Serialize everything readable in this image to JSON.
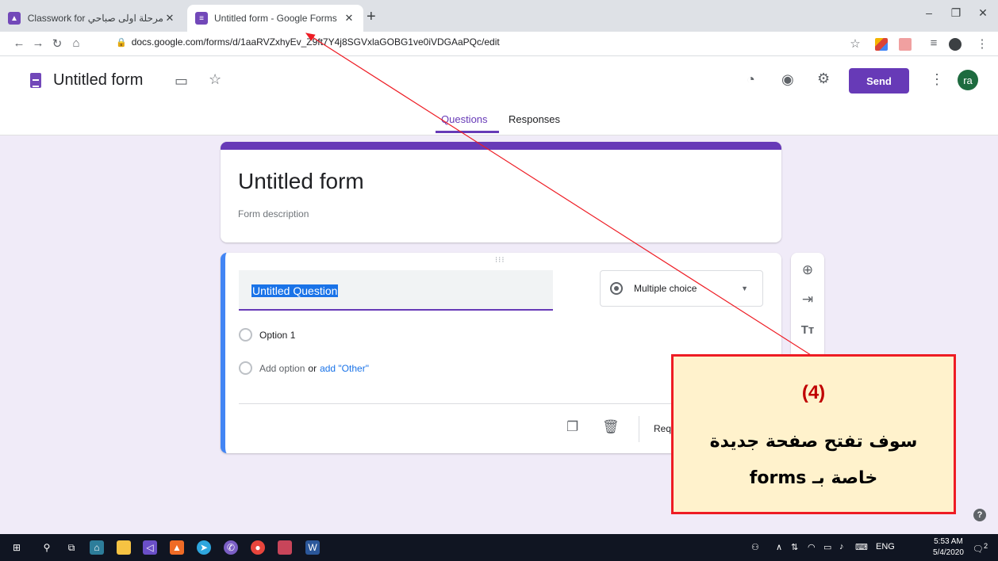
{
  "browser": {
    "tabs": [
      {
        "title": "مرحلة اولى صباحي Classwork for",
        "favicon_color": "#7248b9",
        "active": false
      },
      {
        "title": "Untitled form - Google Forms",
        "favicon_color": "#7248b9",
        "active": true
      }
    ],
    "close_glyph": "✕",
    "newtab_glyph": "+",
    "url": "docs.google.com/forms/d/1aaRVZxhyEv_Z9ft7Y4j8SGVxlaGOBG1ve0iVDGAaPQc/edit",
    "window_controls": {
      "minimize": "–",
      "restore": "❐",
      "close": "✕"
    }
  },
  "forms_header": {
    "title": "Untitled form",
    "send_label": "Send",
    "avatar_initials": "ra",
    "tabs": {
      "questions": "Questions",
      "responses": "Responses"
    },
    "accent_color": "#673ab7"
  },
  "form": {
    "title": "Untitled form",
    "description_placeholder": "Form description",
    "question": {
      "title": "Untitled Question",
      "type": "Multiple choice",
      "option_1": "Option 1",
      "add_option": "Add option",
      "or_text": "or",
      "add_other": "add \"Other\"",
      "required_label": "Req"
    }
  },
  "annotation": {
    "number": "(4)",
    "line_1": "سوف تفتح صفحة جديدة",
    "line_2": "خاصة بـ forms",
    "border_color": "#ee1c24",
    "fill_color": "#fff2cc"
  },
  "taskbar": {
    "time": "5:53 AM",
    "date": "5/4/2020",
    "language": "ENG",
    "notification_count": "2"
  },
  "help_glyph": "?"
}
